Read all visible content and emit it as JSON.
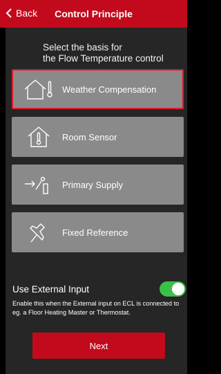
{
  "header": {
    "back_label": "Back",
    "title": "Control Principle"
  },
  "instructions": {
    "line1": "Select the basis for",
    "line2": "the Flow Temperature control"
  },
  "options": [
    {
      "label": "Weather Compensation",
      "icon": "house-thermometer-icon",
      "selected": true
    },
    {
      "label": "Room Sensor",
      "icon": "house-sensor-icon",
      "selected": false
    },
    {
      "label": "Primary Supply",
      "icon": "primary-supply-icon",
      "selected": false
    },
    {
      "label": "Fixed Reference",
      "icon": "pin-icon",
      "selected": false
    }
  ],
  "external_input": {
    "label": "Use External Input",
    "enabled": true,
    "description": "Enable this when the External input on ECL is connected to eg. a Floor Heating Master or Thermostat."
  },
  "next_label": "Next",
  "colors": {
    "accent": "#c30a1c",
    "selected_border": "#e11a2c",
    "option_bg": "#8a8a8a",
    "panel_bg": "#262626",
    "toggle_on": "#3cc04a"
  }
}
